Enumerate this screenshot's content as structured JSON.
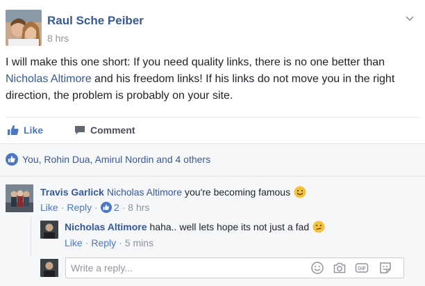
{
  "post": {
    "author": "Raul Sche Peiber",
    "time": "8 hrs",
    "body": {
      "before": "I will make this one short: If you need quality links, there is no one better than ",
      "mention": "Nicholas Altimore",
      "after": " and his freedom links! If his links do not move you in the right direction, the problem is probably on your site."
    }
  },
  "actions": {
    "like": "Like",
    "comment": "Comment"
  },
  "reactions": {
    "text": "You, Rohin Dua, Amirul Nordin and 4 others"
  },
  "comments": [
    {
      "author": "Travis Garlick",
      "mention": "Nicholas Altimore",
      "text": "you're becoming famous",
      "like": "Like",
      "reply": "Reply",
      "likes": "2",
      "time": "8 hrs",
      "replies": [
        {
          "author": "Nicholas Altimore",
          "text": "haha.. well lets hope its not just a fad",
          "like": "Like",
          "reply": "Reply",
          "time": "5 mins"
        }
      ]
    }
  ],
  "reply_box": {
    "placeholder": "Write a reply..."
  },
  "colors": {
    "link": "#365899",
    "action": "#4b76c2",
    "meta": "#90949c",
    "panel": "#f6f7f9"
  }
}
